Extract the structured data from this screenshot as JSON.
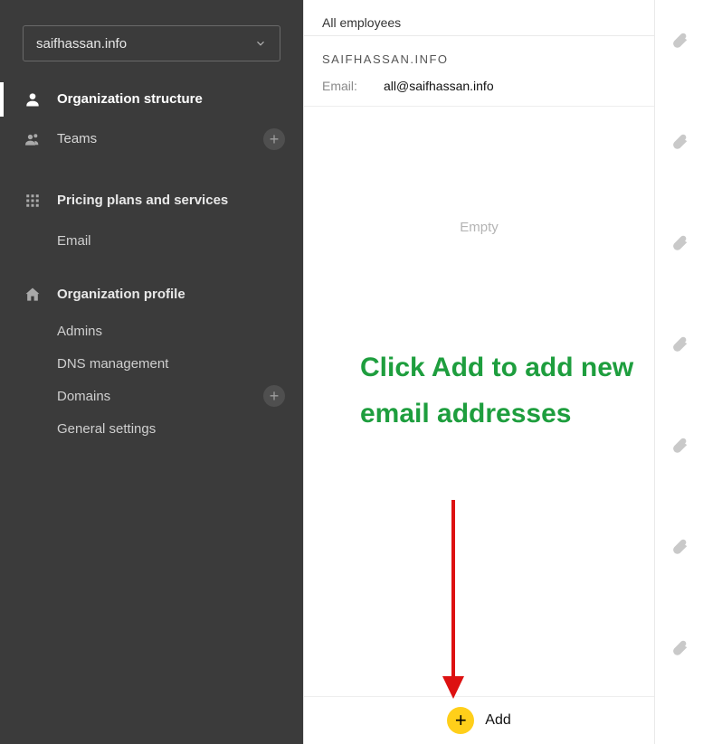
{
  "domain_selector": {
    "value": "saifhassan.info"
  },
  "sidebar": {
    "org_structure": "Organization structure",
    "teams": "Teams",
    "pricing": "Pricing plans and services",
    "pricing_children": {
      "email": "Email"
    },
    "profile": "Organization profile",
    "profile_children": {
      "admins": "Admins",
      "dns": "DNS management",
      "domains": "Domains",
      "general": "General settings"
    }
  },
  "main": {
    "tab": "All employees",
    "org_heading": "SAIFHASSAN.INFO",
    "email_label": "Email:",
    "email_value": "all@saifhassan.info",
    "empty": "Empty",
    "add_label": "Add"
  },
  "annotation": {
    "text": "Click Add to add new email addresses"
  }
}
